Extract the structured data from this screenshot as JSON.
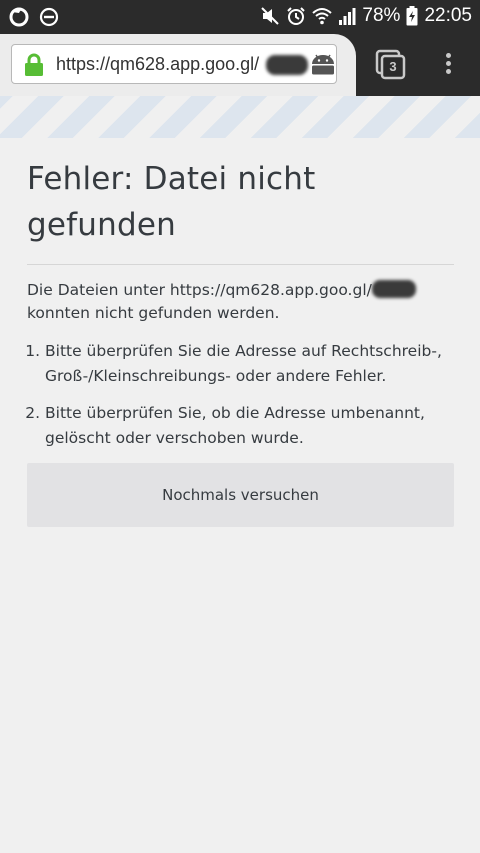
{
  "status_bar": {
    "battery_percent": "78%",
    "time": "22:05",
    "icons": [
      "firefox-icon",
      "do-not-disturb-icon",
      "mute-icon",
      "alarm-icon",
      "wifi-icon",
      "signal-icon",
      "battery-charging-icon"
    ]
  },
  "toolbar": {
    "url": "https://qm628.app.goo.gl/",
    "tab_count": "3"
  },
  "error_page": {
    "title_line1": "Fehler: Datei nicht",
    "title_line2": "gefunden",
    "description_part1": "Die Dateien unter https://qm628.app.goo.gl/",
    "description_part2": "konnten nicht gefunden werden.",
    "suggestions": [
      "Bitte überprüfen Sie die Adresse auf Rechtschreib-, Groß-/Kleinschreibungs- oder andere Fehler.",
      "Bitte überprüfen Sie, ob die Adresse umbenannt, gelöscht oder verschoben wurde."
    ],
    "retry_label": "Nochmals versuchen"
  },
  "colors": {
    "toolbar_dark": "#2b2b2b",
    "lock_green": "#57bd35",
    "page_background": "#f0f0f0",
    "text": "#363b40",
    "button_bg": "#e2e2e4"
  }
}
